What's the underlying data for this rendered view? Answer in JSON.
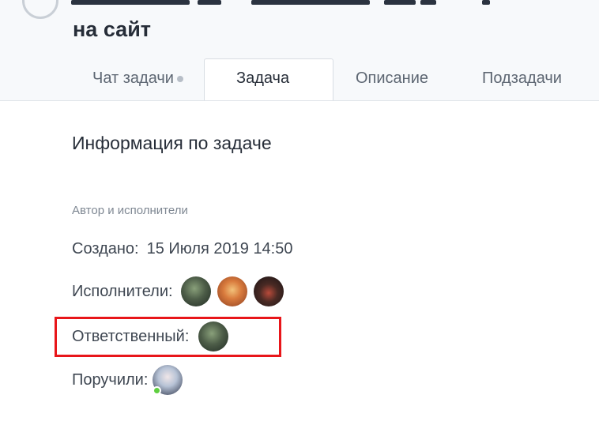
{
  "task": {
    "title_line2": "на сайт"
  },
  "tabs": [
    {
      "label": "Чат задачи",
      "has_dot": true
    },
    {
      "label": "Задача",
      "active": true
    },
    {
      "label": "Описание"
    },
    {
      "label": "Подзадачи"
    }
  ],
  "info": {
    "section_title": "Информация по задаче",
    "group_label": "Автор и исполнители",
    "created_label": "Создано:",
    "created_value": "15 Июля 2019 14:50",
    "performers_label": "Исполнители:",
    "responsible_label": "Ответственный:",
    "assigned_by_label": "Поручили:"
  },
  "avatars": {
    "performers": [
      "avatar-green-icon",
      "avatar-food-icon",
      "avatar-dark-icon"
    ],
    "responsible": [
      "avatar-green-icon"
    ],
    "assigned_by": [
      "avatar-person-icon"
    ]
  },
  "colors": {
    "highlight": "#e8161a",
    "online_status": "#5fcf3f"
  }
}
